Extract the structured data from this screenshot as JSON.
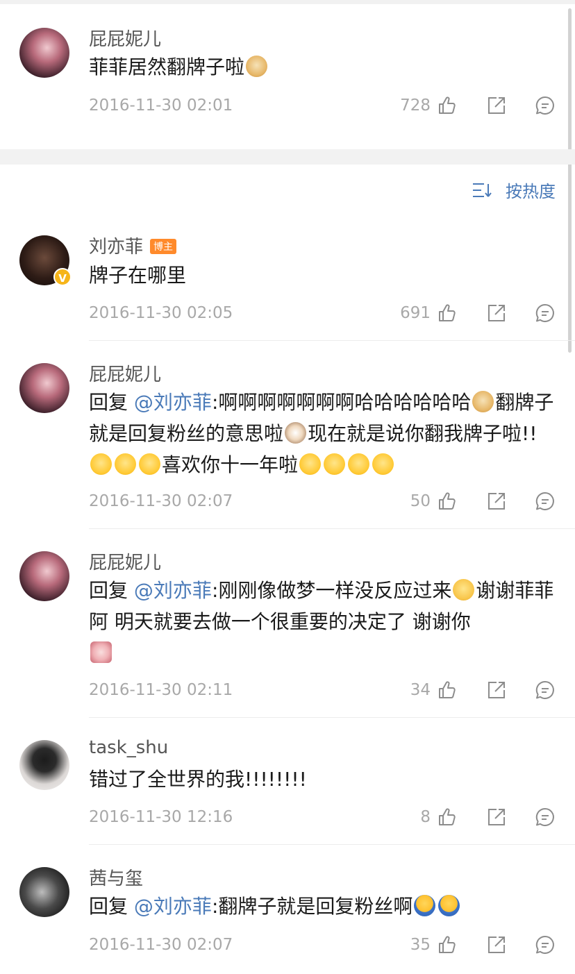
{
  "sort": {
    "label": "按热度",
    "icon": "sort-icon"
  },
  "colors": {
    "link": "#4a7ab8",
    "meta": "#a8a8a8",
    "badge": "#ff8a2b"
  },
  "original_post": {
    "name": "屁屁妮儿",
    "text": "菲菲居然翻牌子啦",
    "time": "2016-11-30 02:01",
    "likes": "728"
  },
  "comments": [
    {
      "name": "刘亦菲",
      "badge": "博主",
      "verified": true,
      "text": "牌子在哪里",
      "time": "2016-11-30 02:05",
      "likes": "691"
    },
    {
      "name": "屁屁妮儿",
      "reply_prefix": "回复",
      "mention": "@刘亦菲",
      "text_a": ":啊啊啊啊啊啊啊哈哈哈哈哈哈",
      "text_b": "翻牌子就是回复粉丝的意思啦",
      "text_c": "现在就是说你翻我牌子啦!!",
      "text_d": "喜欢你十一年啦",
      "time": "2016-11-30 02:07",
      "likes": "50"
    },
    {
      "name": "屁屁妮儿",
      "reply_prefix": "回复",
      "mention": "@刘亦菲",
      "text_a": ":刚刚像做梦一样没反应过来",
      "text_b": "谢谢菲菲阿 明天就要去做一个很重要的决定了 谢谢你",
      "time": "2016-11-30 02:11",
      "likes": "34"
    },
    {
      "name": "task_shu",
      "text": "错过了全世界的我!!!!!!!!",
      "time": "2016-11-30 12:16",
      "likes": "8"
    },
    {
      "name": "茜与玺",
      "reply_prefix": "回复",
      "mention": "@刘亦菲",
      "text_a": ":翻牌子就是回复粉丝啊",
      "time": "2016-11-30 02:07",
      "likes": "35"
    }
  ]
}
